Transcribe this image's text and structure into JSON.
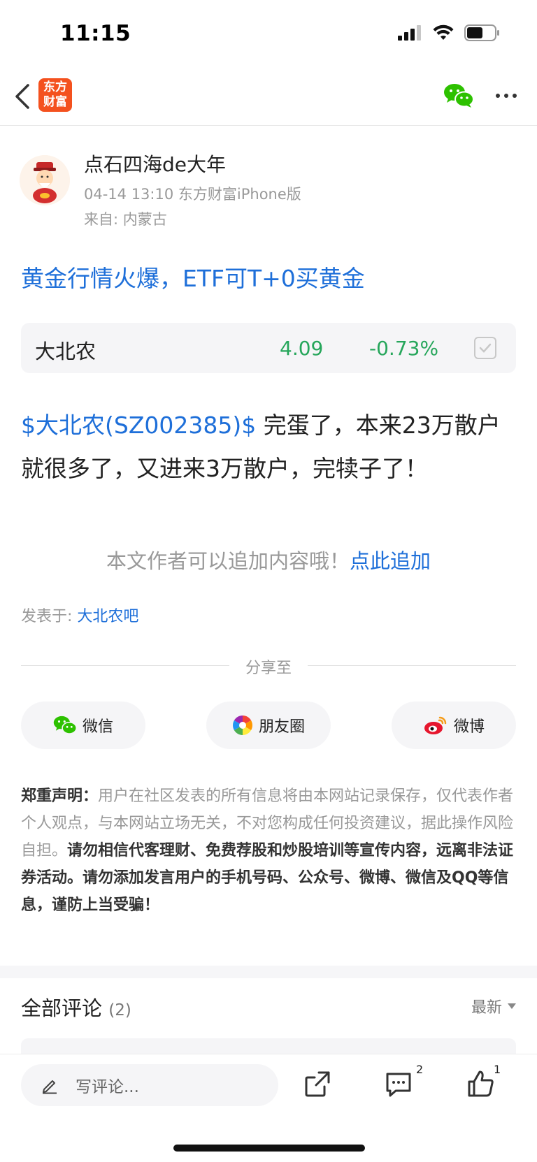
{
  "status_bar": {
    "time": "11:15"
  },
  "nav": {
    "app_logo_line1": "东方",
    "app_logo_line2": "财富"
  },
  "author": {
    "name": "点石四海de大年",
    "meta": "04-14 13:10 东方财富iPhone版",
    "from": "来自: 内蒙古"
  },
  "post": {
    "title": "黄金行情火爆，ETF可T+0买黄金",
    "stock_link": "$大北农(SZ002385)$",
    "body_text": "完蛋了，本来23万散户就很多了，又进来3万散户，完犊子了！"
  },
  "stock_card": {
    "name": "大北农",
    "price": "4.09",
    "change": "-0.73%"
  },
  "append": {
    "note": "本文作者可以追加内容哦！",
    "link": "点此追加"
  },
  "posted_in": {
    "label": "发表于: ",
    "forum": "大北农吧"
  },
  "share": {
    "label": "分享至",
    "wechat": "微信",
    "moments": "朋友圈",
    "weibo": "微博"
  },
  "disclaimer": {
    "heading": "郑重声明：",
    "normal": "用户在社区发表的所有信息将由本网站记录保存，仅代表作者个人观点，与本网站立场无关，不对您构成任何投资建议，据此操作风险自担。",
    "bold": "请勿相信代客理财、免费荐股和炒股培训等宣传内容，远离非法证券活动。请勿添加发言用户的手机号码、公众号、微博、微信及QQ等信息，谨防上当受骗！"
  },
  "comments": {
    "title": "全部评论",
    "count": "(2)",
    "sort": "最新"
  },
  "bottom_bar": {
    "input_placeholder": "写评论...",
    "comment_badge": "2",
    "like_badge": "1"
  },
  "colors": {
    "link": "#1e6fd9",
    "down": "#26a65b",
    "brand": "#f4511e"
  }
}
